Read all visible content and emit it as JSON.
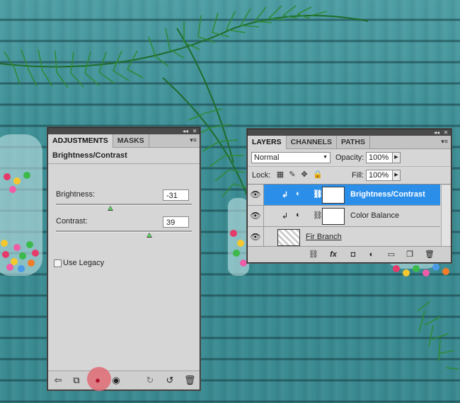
{
  "adjustments_panel": {
    "tabs": [
      "ADJUSTMENTS",
      "MASKS"
    ],
    "title": "Brightness/Contrast",
    "brightness_label": "Brightness:",
    "brightness_value": "-31",
    "contrast_label": "Contrast:",
    "contrast_value": "39",
    "brightness_slider_fraction": 0.4,
    "contrast_slider_fraction": 0.69,
    "use_legacy_label": "Use Legacy",
    "use_legacy_checked": false,
    "bottom_icons": [
      "back-arrow-icon",
      "expand-view-icon",
      "clip-to-layer-icon",
      "visibility-eye-icon",
      "previous-state-icon",
      "reset-icon",
      "trash-icon"
    ]
  },
  "layers_panel": {
    "tabs": [
      "LAYERS",
      "CHANNELS",
      "PATHS"
    ],
    "blend_mode": "Normal",
    "opacity_label": "Opacity:",
    "opacity_value": "100%",
    "lock_label": "Lock:",
    "fill_label": "Fill:",
    "fill_value": "100%",
    "layers": [
      {
        "name": "Brightness/Contrast",
        "selected": true,
        "type": "adjustment"
      },
      {
        "name": "Color Balance",
        "selected": false,
        "type": "adjustment"
      },
      {
        "name": "Fir Branch",
        "selected": false,
        "type": "image"
      }
    ],
    "bottom_icons": [
      "link-icon",
      "fx-icon",
      "mask-icon",
      "adjustment-layer-icon",
      "folder-icon",
      "new-layer-icon",
      "trash-icon"
    ],
    "fx_label": "fx"
  },
  "colors": {
    "selection_blue": "#2b8fea",
    "panel_gray": "#d6d6d6",
    "slider_green": "#5ad35a",
    "highlight_red": "#e06b74"
  }
}
